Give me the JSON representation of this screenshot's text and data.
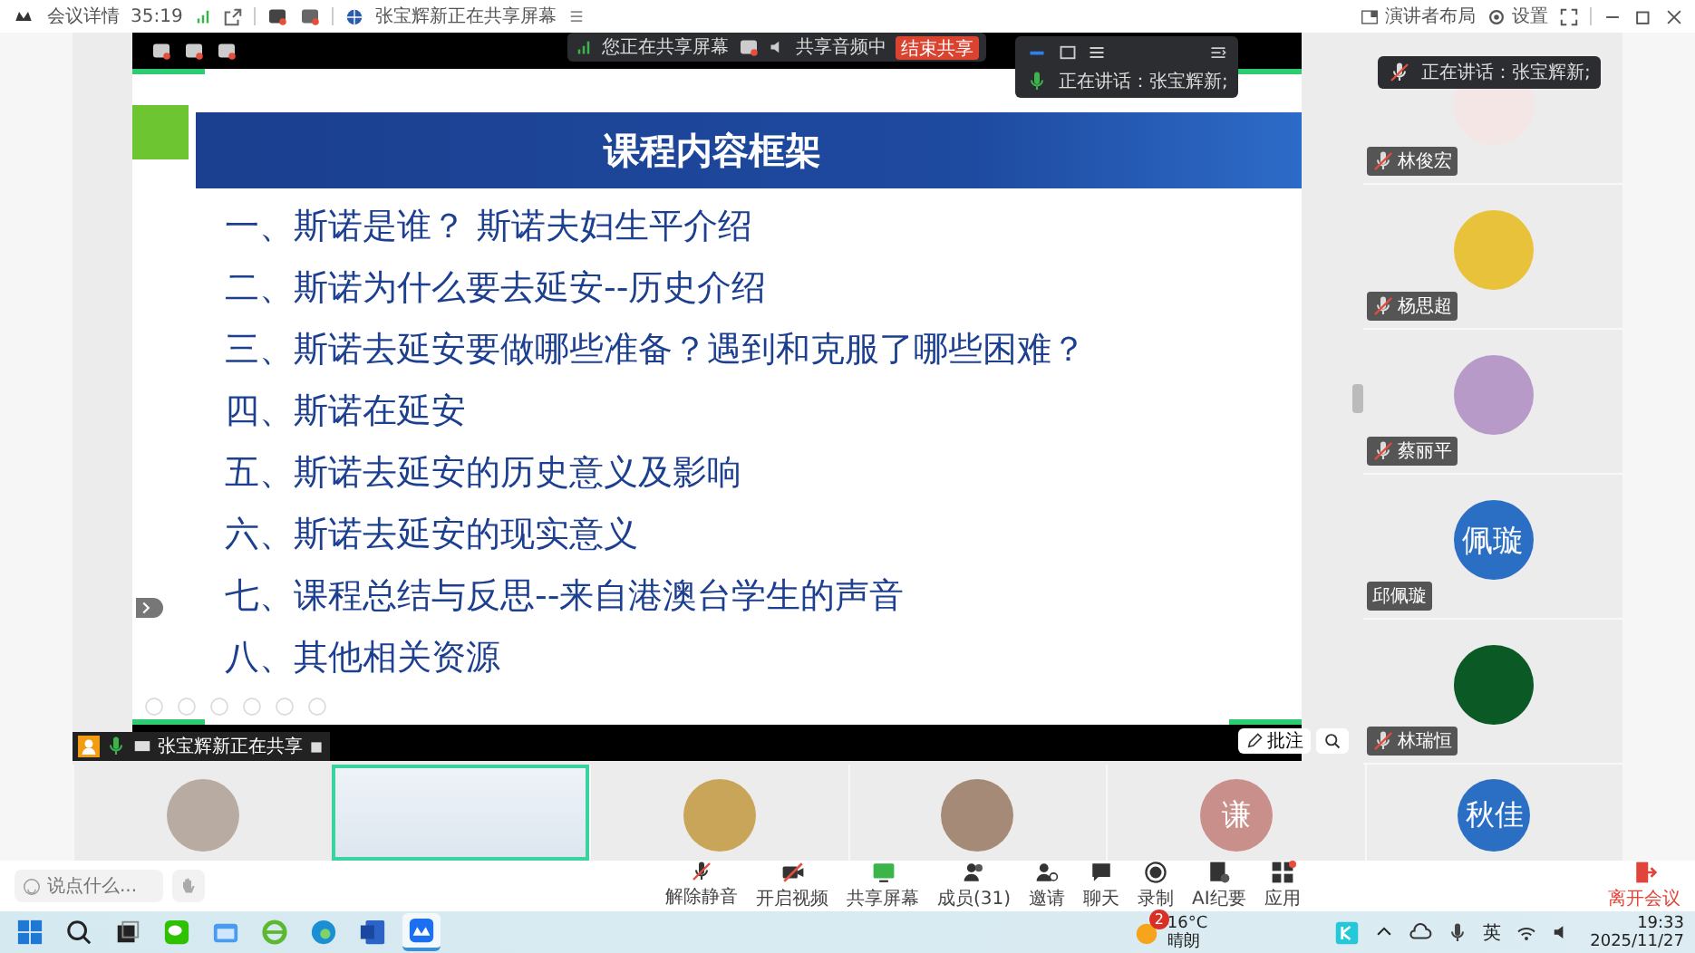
{
  "meeting_bar": {
    "title": "会议详情",
    "duration": "35:19",
    "sharing_notice": "张宝辉新正在共享屏幕",
    "layout_menu": "演讲者布局",
    "settings": "设置"
  },
  "share_toolbar": {
    "status": "您正在共享屏幕",
    "audio": "共享音频中",
    "stop_button": "结束共享"
  },
  "speaker_popup": {
    "label": "正在讲话：张宝辉新;"
  },
  "slide": {
    "title": "课程内容框架",
    "items": [
      "一、斯诺是谁？ 斯诺夫妇生平介绍",
      "二、斯诺为什么要去延安--历史介绍",
      "三、斯诺去延安要做哪些准备？遇到和克服了哪些困难？",
      "四、斯诺在延安",
      "五、斯诺去延安的历史意义及影响",
      "六、斯诺去延安的现实意义",
      "七、课程总结与反思--来自港澳台学生的声音",
      "八、其他相关资源"
    ]
  },
  "sharer_label": "张宝辉新正在共享",
  "annotate_button": "批注",
  "side_speaker_popup": {
    "label": "正在讲话：张宝辉新;"
  },
  "side_participants": [
    {
      "name": "林俊宏",
      "muted": true,
      "kind": "image",
      "color": "#f3e6e4"
    },
    {
      "name": "杨思超",
      "muted": true,
      "kind": "image",
      "color": "#e8c23a"
    },
    {
      "name": "蔡丽平",
      "muted": true,
      "kind": "image",
      "color": "#b79ac8"
    },
    {
      "name": "邱佩璇",
      "muted": false,
      "kind": "text",
      "text": "佩璇",
      "color": "#2a6fc4"
    },
    {
      "name": "林瑞恒",
      "muted": true,
      "kind": "image",
      "color": "#0b5a26"
    }
  ],
  "gallery": [
    {
      "kind": "image",
      "color": "#b7aba2",
      "active": false
    },
    {
      "kind": "video",
      "active": true
    },
    {
      "kind": "image",
      "color": "#c9a55a",
      "active": false
    },
    {
      "kind": "image",
      "color": "#a58a78",
      "active": false
    },
    {
      "kind": "text",
      "text": "谦",
      "color": "#c98f8a",
      "active": false
    },
    {
      "kind": "text",
      "text": "秋佳",
      "color": "#2a6fc4",
      "active": false
    }
  ],
  "toolbar": {
    "chat_placeholder": "说点什么...",
    "buttons": [
      {
        "kind": "mic",
        "label": "解除静音",
        "off": true,
        "badge": false
      },
      {
        "kind": "camera",
        "label": "开启视频",
        "off": true,
        "badge": false
      },
      {
        "kind": "share",
        "label": "共享屏幕",
        "off": false,
        "badge": false
      },
      {
        "kind": "members",
        "label": "成员(31)",
        "off": false,
        "badge": false
      },
      {
        "kind": "invite",
        "label": "邀请",
        "off": false,
        "badge": false
      },
      {
        "kind": "chat",
        "label": "聊天",
        "off": false,
        "badge": false
      },
      {
        "kind": "record",
        "label": "录制",
        "off": false,
        "badge": false
      },
      {
        "kind": "ai",
        "label": "AI纪要",
        "off": false,
        "badge": false
      },
      {
        "kind": "apps",
        "label": "应用",
        "off": false,
        "badge": true
      }
    ],
    "leave_button": "离开会议"
  },
  "taskbar": {
    "apps": [
      {
        "kind": "start",
        "selected": false
      },
      {
        "kind": "search",
        "selected": false
      },
      {
        "kind": "taskview",
        "selected": false
      },
      {
        "kind": "chat",
        "selected": false
      },
      {
        "kind": "files",
        "selected": false
      },
      {
        "kind": "browser",
        "selected": false
      },
      {
        "kind": "edge",
        "selected": false
      },
      {
        "kind": "word",
        "selected": false
      },
      {
        "kind": "meeting",
        "selected": true
      }
    ],
    "weather": {
      "badge": "2",
      "temperature": "16°C",
      "condition": "晴朗"
    },
    "input_method": "英",
    "time": "19:33",
    "date": "2025/11/27"
  }
}
